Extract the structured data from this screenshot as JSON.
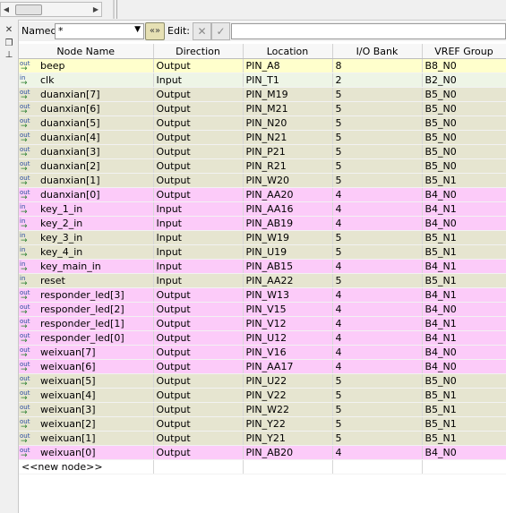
{
  "toolbar": {
    "named_label": "Named:",
    "named_value": "*",
    "edit_label": "Edit:",
    "edit_value": ""
  },
  "columns": [
    "Node Name",
    "Direction",
    "Location",
    "I/O Bank",
    "VREF Group"
  ],
  "rows": [
    {
      "name": "beep",
      "dir": "Output",
      "loc": "PIN_A8",
      "bank": "8",
      "vref": "B8_N0",
      "icon": "out",
      "color": "yellow"
    },
    {
      "name": "clk",
      "dir": "Input",
      "loc": "PIN_T1",
      "bank": "2",
      "vref": "B2_N0",
      "icon": "in",
      "color": "green"
    },
    {
      "name": "duanxian[7]",
      "dir": "Output",
      "loc": "PIN_M19",
      "bank": "5",
      "vref": "B5_N0",
      "icon": "out",
      "color": "tan"
    },
    {
      "name": "duanxian[6]",
      "dir": "Output",
      "loc": "PIN_M21",
      "bank": "5",
      "vref": "B5_N0",
      "icon": "out",
      "color": "tan"
    },
    {
      "name": "duanxian[5]",
      "dir": "Output",
      "loc": "PIN_N20",
      "bank": "5",
      "vref": "B5_N0",
      "icon": "out",
      "color": "tan"
    },
    {
      "name": "duanxian[4]",
      "dir": "Output",
      "loc": "PIN_N21",
      "bank": "5",
      "vref": "B5_N0",
      "icon": "out",
      "color": "tan"
    },
    {
      "name": "duanxian[3]",
      "dir": "Output",
      "loc": "PIN_P21",
      "bank": "5",
      "vref": "B5_N0",
      "icon": "out",
      "color": "tan"
    },
    {
      "name": "duanxian[2]",
      "dir": "Output",
      "loc": "PIN_R21",
      "bank": "5",
      "vref": "B5_N0",
      "icon": "out",
      "color": "tan"
    },
    {
      "name": "duanxian[1]",
      "dir": "Output",
      "loc": "PIN_W20",
      "bank": "5",
      "vref": "B5_N1",
      "icon": "out",
      "color": "tan"
    },
    {
      "name": "duanxian[0]",
      "dir": "Output",
      "loc": "PIN_AA20",
      "bank": "4",
      "vref": "B4_N0",
      "icon": "out",
      "color": "pink"
    },
    {
      "name": "key_1_in",
      "dir": "Input",
      "loc": "PIN_AA16",
      "bank": "4",
      "vref": "B4_N1",
      "icon": "in",
      "color": "pink"
    },
    {
      "name": "key_2_in",
      "dir": "Input",
      "loc": "PIN_AB19",
      "bank": "4",
      "vref": "B4_N0",
      "icon": "in",
      "color": "pink"
    },
    {
      "name": "key_3_in",
      "dir": "Input",
      "loc": "PIN_W19",
      "bank": "5",
      "vref": "B5_N1",
      "icon": "in",
      "color": "tan"
    },
    {
      "name": "key_4_in",
      "dir": "Input",
      "loc": "PIN_U19",
      "bank": "5",
      "vref": "B5_N1",
      "icon": "in",
      "color": "tan"
    },
    {
      "name": "key_main_in",
      "dir": "Input",
      "loc": "PIN_AB15",
      "bank": "4",
      "vref": "B4_N1",
      "icon": "in",
      "color": "pink"
    },
    {
      "name": "reset",
      "dir": "Input",
      "loc": "PIN_AA22",
      "bank": "5",
      "vref": "B5_N1",
      "icon": "in",
      "color": "tan"
    },
    {
      "name": "responder_led[3]",
      "dir": "Output",
      "loc": "PIN_W13",
      "bank": "4",
      "vref": "B4_N1",
      "icon": "out",
      "color": "pink"
    },
    {
      "name": "responder_led[2]",
      "dir": "Output",
      "loc": "PIN_V15",
      "bank": "4",
      "vref": "B4_N0",
      "icon": "out",
      "color": "pink"
    },
    {
      "name": "responder_led[1]",
      "dir": "Output",
      "loc": "PIN_V12",
      "bank": "4",
      "vref": "B4_N1",
      "icon": "out",
      "color": "pink"
    },
    {
      "name": "responder_led[0]",
      "dir": "Output",
      "loc": "PIN_U12",
      "bank": "4",
      "vref": "B4_N1",
      "icon": "out",
      "color": "pink"
    },
    {
      "name": "weixuan[7]",
      "dir": "Output",
      "loc": "PIN_V16",
      "bank": "4",
      "vref": "B4_N0",
      "icon": "out",
      "color": "pink"
    },
    {
      "name": "weixuan[6]",
      "dir": "Output",
      "loc": "PIN_AA17",
      "bank": "4",
      "vref": "B4_N0",
      "icon": "out",
      "color": "pink"
    },
    {
      "name": "weixuan[5]",
      "dir": "Output",
      "loc": "PIN_U22",
      "bank": "5",
      "vref": "B5_N0",
      "icon": "out",
      "color": "tan"
    },
    {
      "name": "weixuan[4]",
      "dir": "Output",
      "loc": "PIN_V22",
      "bank": "5",
      "vref": "B5_N1",
      "icon": "out",
      "color": "tan"
    },
    {
      "name": "weixuan[3]",
      "dir": "Output",
      "loc": "PIN_W22",
      "bank": "5",
      "vref": "B5_N1",
      "icon": "out",
      "color": "tan"
    },
    {
      "name": "weixuan[2]",
      "dir": "Output",
      "loc": "PIN_Y22",
      "bank": "5",
      "vref": "B5_N1",
      "icon": "out",
      "color": "tan"
    },
    {
      "name": "weixuan[1]",
      "dir": "Output",
      "loc": "PIN_Y21",
      "bank": "5",
      "vref": "B5_N1",
      "icon": "out",
      "color": "tan"
    },
    {
      "name": "weixuan[0]",
      "dir": "Output",
      "loc": "PIN_AB20",
      "bank": "4",
      "vref": "B4_N0",
      "icon": "out",
      "color": "pink"
    }
  ],
  "new_node_label": "<<new node>>",
  "icons": {
    "out": "out",
    "in": "in",
    "arrow": "→"
  },
  "colors": {
    "yellow": "#ffffcc",
    "tan": "#e6e5d0",
    "pink": "#fccbf9",
    "green": "#eef5e6"
  }
}
